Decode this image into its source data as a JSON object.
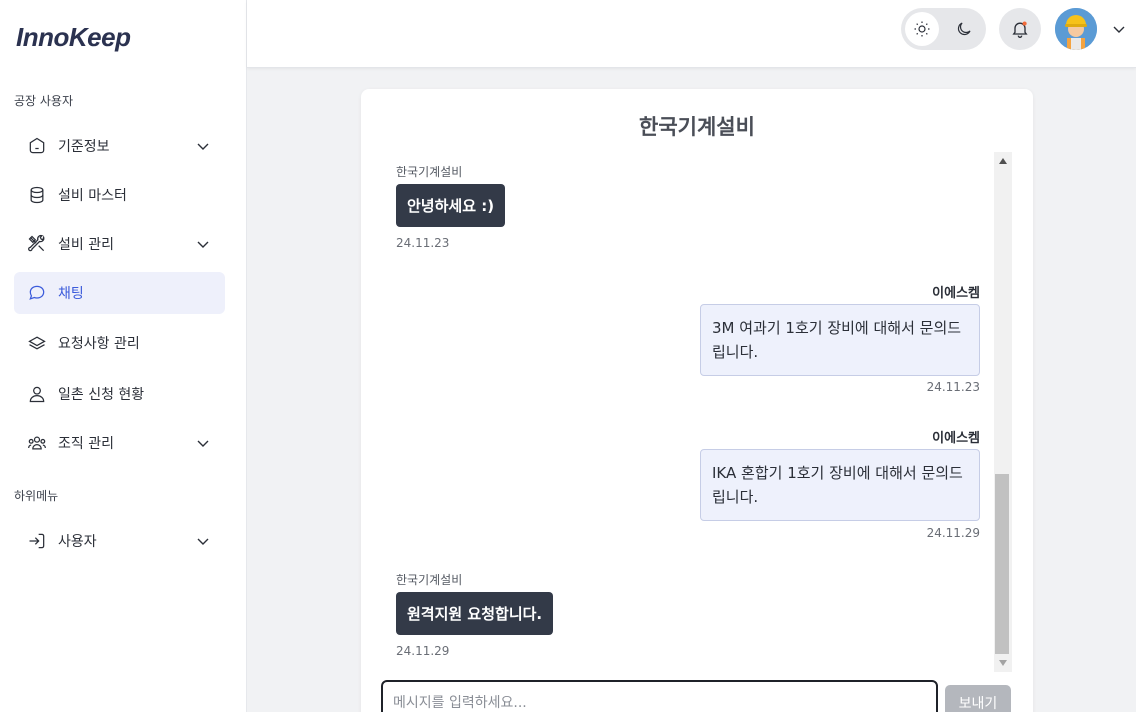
{
  "app": {
    "logo": "InnoKeep"
  },
  "sidebar": {
    "section_factory": "공장 사용자",
    "section_sub": "하위메뉴",
    "items": [
      {
        "label": "기준정보",
        "icon": "base-info-icon",
        "has_chevron": true
      },
      {
        "label": "설비 마스터",
        "icon": "database-icon",
        "has_chevron": false
      },
      {
        "label": "설비 관리",
        "icon": "tools-icon",
        "has_chevron": true
      },
      {
        "label": "채팅",
        "icon": "chat-icon",
        "has_chevron": false,
        "active": true
      },
      {
        "label": "요청사항 관리",
        "icon": "layers-icon",
        "has_chevron": false
      },
      {
        "label": "일촌 신청 현황",
        "icon": "user-icon",
        "has_chevron": false
      },
      {
        "label": "조직 관리",
        "icon": "group-icon",
        "has_chevron": true
      },
      {
        "label": "사용자",
        "icon": "login-icon",
        "has_chevron": true
      }
    ]
  },
  "header": {
    "theme": "light",
    "icons": [
      "sun-icon",
      "moon-icon",
      "bell-icon",
      "avatar",
      "chevron-down-icon"
    ]
  },
  "chat": {
    "title": "한국기계설비",
    "messages": [
      {
        "side": "left",
        "sender": "한국기계설비",
        "text": "안녕하세요 :)",
        "date": "24.11.23"
      },
      {
        "side": "right",
        "sender": "이에스켐",
        "text": "3M 여과기 1호기 장비에 대해서 문의드립니다.",
        "date": "24.11.23"
      },
      {
        "side": "right",
        "sender": "이에스켐",
        "text": "IKA 혼합기 1호기 장비에 대해서 문의드립니다.",
        "date": "24.11.29"
      },
      {
        "side": "left",
        "sender": "한국기계설비",
        "text": "원격지원 요청합니다.",
        "date": "24.11.29"
      }
    ],
    "input_placeholder": "메시지를 입력하세요...",
    "send_label": "보내기"
  },
  "colors": {
    "accent": "#3b5bdb",
    "dark_bubble": "#333a48",
    "light_bubble": "#eef1fc"
  }
}
